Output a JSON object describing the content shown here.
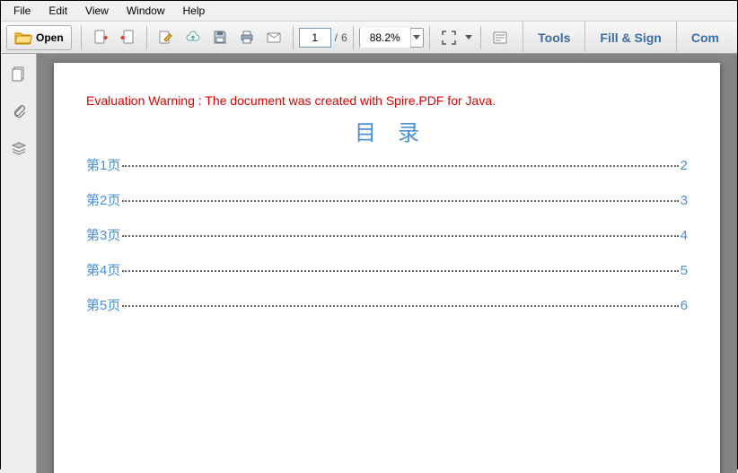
{
  "menu": {
    "file": "File",
    "edit": "Edit",
    "view": "View",
    "window": "Window",
    "help": "Help"
  },
  "toolbar": {
    "open": "Open",
    "page_current": "1",
    "page_sep": "/",
    "page_total": "6",
    "zoom": "88.2%"
  },
  "right": {
    "tools": "Tools",
    "fillsign": "Fill & Sign",
    "comment": "Com"
  },
  "doc": {
    "warning": "Evaluation Warning : The document was created with Spire.PDF for Java.",
    "toc_title": "目录",
    "toc": [
      {
        "label": "第1页",
        "page": "2"
      },
      {
        "label": "第2页",
        "page": "3"
      },
      {
        "label": "第3页",
        "page": "4"
      },
      {
        "label": "第4页",
        "page": "5"
      },
      {
        "label": "第5页",
        "page": "6"
      }
    ]
  }
}
